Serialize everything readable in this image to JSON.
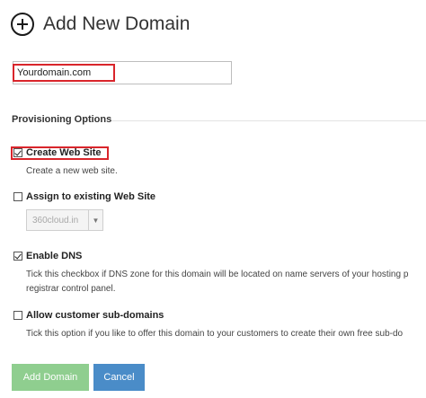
{
  "header": {
    "title": "Add New Domain",
    "icon": "plus-circle-icon"
  },
  "domain": {
    "value": "Yourdomain.com"
  },
  "provisioning": {
    "title": "Provisioning Options",
    "create_site": {
      "label": "Create Web Site",
      "checked": true,
      "description": "Create a new web site."
    },
    "assign_site": {
      "label": "Assign to existing Web Site",
      "checked": false,
      "select_value": "360cloud.in"
    },
    "enable_dns": {
      "label": "Enable DNS",
      "checked": true,
      "description_line1": "Tick this checkbox if DNS zone for this domain will be located on name servers of your hosting p",
      "description_line2": "registrar control panel."
    },
    "allow_subdomains": {
      "label": "Allow customer sub-domains",
      "checked": false,
      "description": "Tick this option if you like to offer this domain to your customers to create their own free sub-do"
    }
  },
  "buttons": {
    "add_label": "Add Domain",
    "cancel_label": "Cancel"
  },
  "colors": {
    "highlight": "#d9252b",
    "add_button": "#8fce8f",
    "cancel_button": "#4a8cc8"
  }
}
